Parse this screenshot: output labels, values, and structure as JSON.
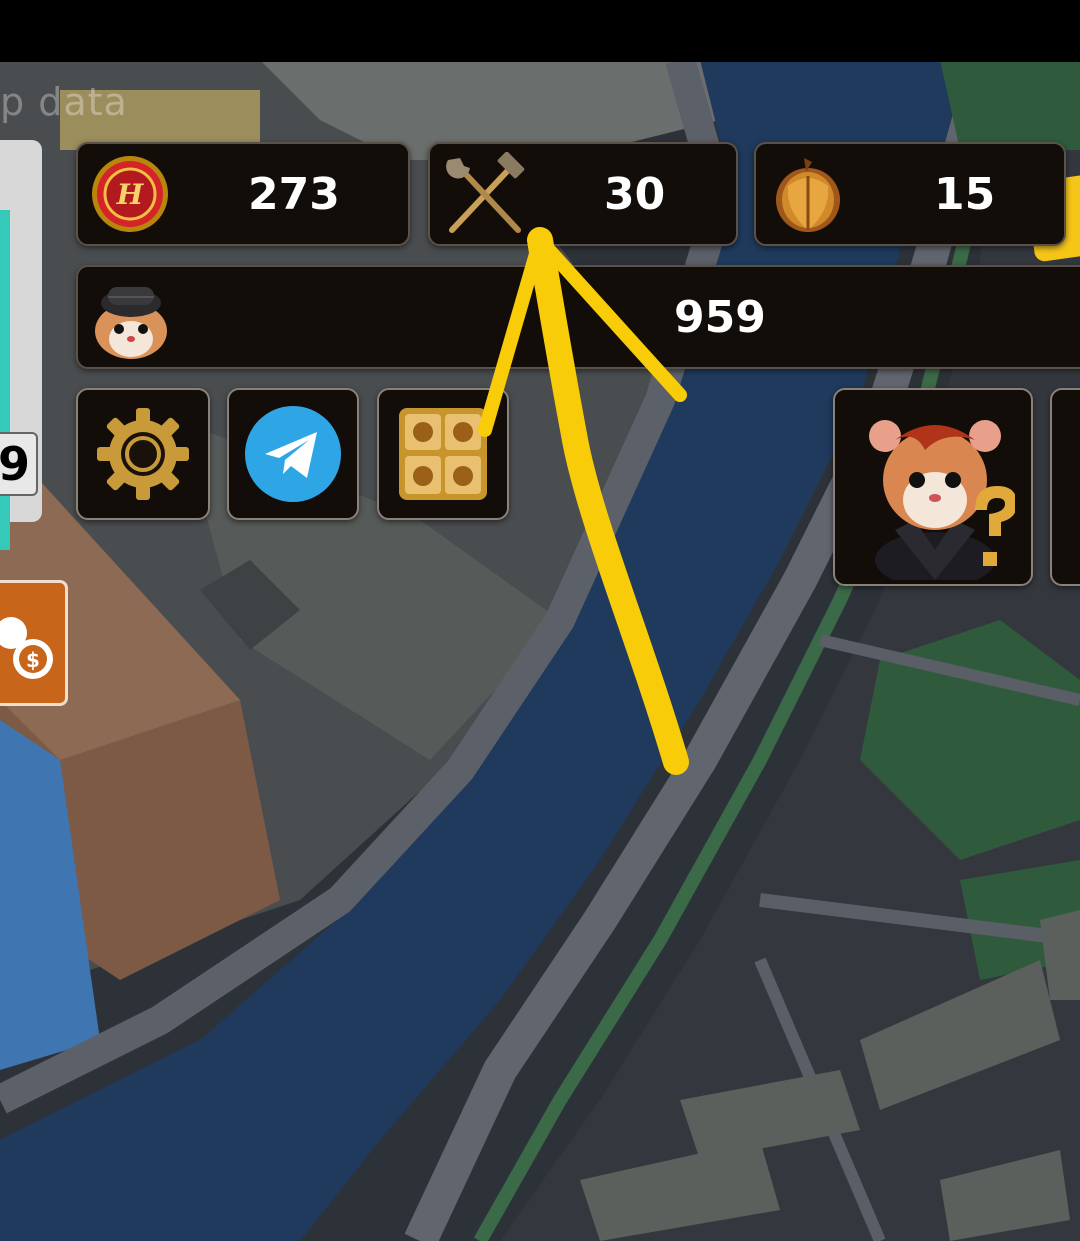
{
  "map": {
    "attribution_text": "p data"
  },
  "resources": {
    "coins": {
      "icon": "hamster-coin-icon",
      "value": "273"
    },
    "tools": {
      "icon": "hammer-wrench-icon",
      "value": "30"
    },
    "nuts": {
      "icon": "golden-nut-icon",
      "value": "15"
    }
  },
  "player": {
    "icon": "hamster-detective-avatar-icon",
    "value": "959"
  },
  "buttons": {
    "settings": {
      "icon": "gear-icon"
    },
    "telegram": {
      "icon": "telegram-icon"
    },
    "hamster_gallery": {
      "icon": "hamster-grid-icon"
    },
    "help_character": {
      "icon": "hamster-question-icon"
    }
  },
  "left_panel": {
    "number": "9"
  },
  "colors": {
    "panel_bg": "#120d08",
    "water": "#1f3a5c",
    "annotation_arrow": "#f8cc08"
  }
}
